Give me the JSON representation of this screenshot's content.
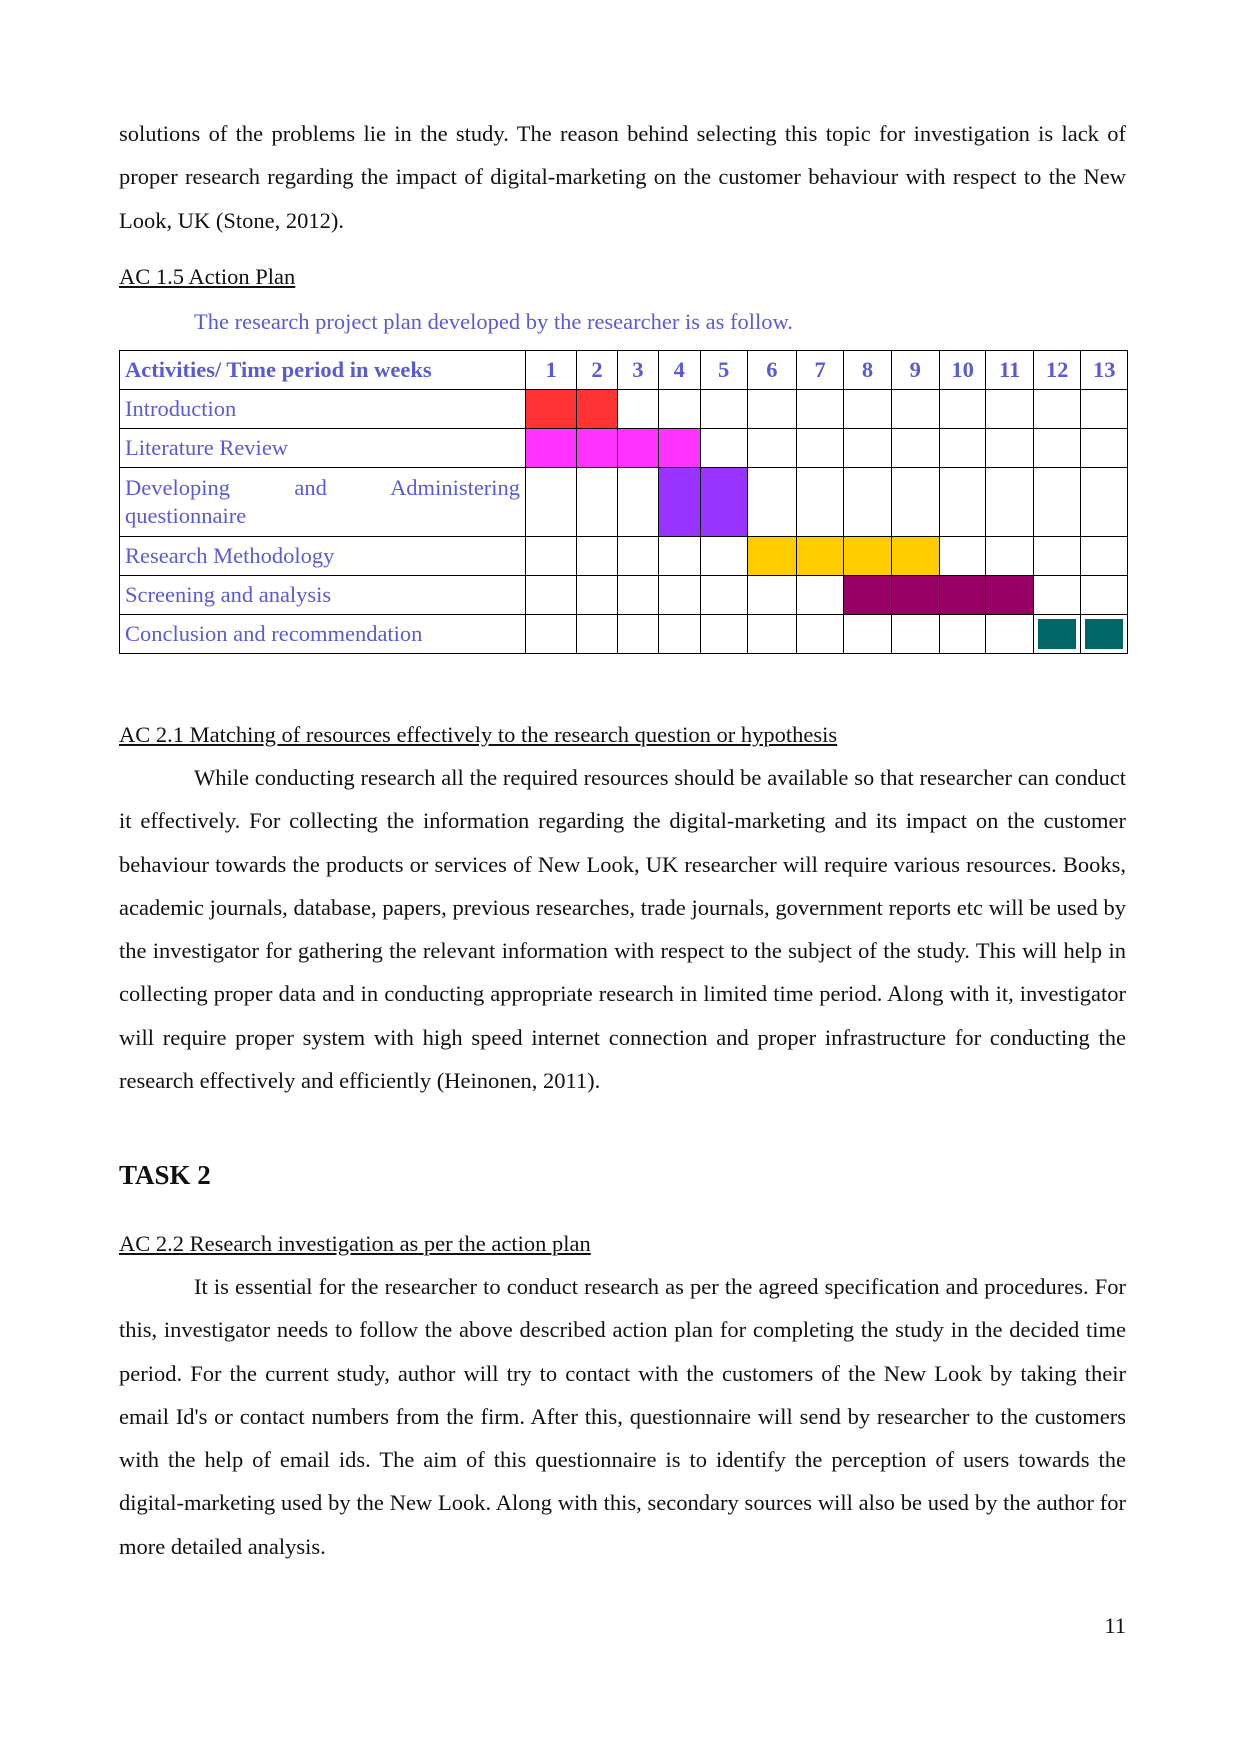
{
  "intro_paragraph": "solutions of the problems lie in the study. The reason behind selecting this topic for investigation is lack of proper research regarding the impact of digital-marketing on the customer behaviour with respect to the New Look, UK (Stone, 2012).",
  "section_ac15": {
    "heading": "AC 1.5 Action Plan",
    "caption": "The research project plan developed by the researcher is as follow.",
    "table": {
      "header": "Activities/ Time period in weeks",
      "weeks": [
        "1",
        "2",
        "3",
        "4",
        "5",
        "6",
        "7",
        "8",
        "9",
        "10",
        "11",
        "12",
        "13"
      ],
      "rows": [
        {
          "activity": "Introduction",
          "start": 1,
          "end": 2,
          "color": "#ff3333"
        },
        {
          "activity": "Literature Review",
          "start": 1,
          "end": 4,
          "color": "#ff33ff"
        },
        {
          "activity": "Developing and Administering questionnaire",
          "start": 4,
          "end": 5,
          "color": "#9933ff"
        },
        {
          "activity": "Research Methodology",
          "start": 6,
          "end": 9,
          "color": "#ffcc00"
        },
        {
          "activity": "Screening and analysis",
          "start": 8,
          "end": 11,
          "color": "#990066"
        },
        {
          "activity": "Conclusion and recommendation",
          "start": 12,
          "end": 13,
          "color": "#006666"
        }
      ]
    }
  },
  "section_ac21": {
    "heading": "AC 2.1 Matching of resources effectively to the research question or hypothesis",
    "paragraph": "While conducting research all the required resources should be available so that researcher can conduct it effectively. For collecting the information regarding the digital-marketing and its impact on the customer behaviour towards the products or services of New Look, UK researcher will require various resources. Books, academic journals, database, papers, previous researches, trade journals, government reports etc will be used by the investigator for gathering the relevant information with respect to the subject of the study. This will help in collecting proper data and in conducting appropriate research in limited time period. Along with it, investigator will require proper system with high speed internet connection and proper infrastructure for conducting the research effectively and efficiently (Heinonen, 2011)."
  },
  "task_heading": "TASK 2",
  "section_ac22": {
    "heading": "AC 2.2 Research investigation as per the action plan",
    "paragraph": "It is essential for the researcher to conduct research as per the agreed specification and procedures. For this, investigator needs to follow the above described action plan for completing the study in the decided time period. For the current study, author will try to contact with the customers of the New Look by taking their email Id's or contact numbers from the firm. After this, questionnaire will send by researcher to the customers with the help of email ids. The aim of this questionnaire is to identify the perception of users towards the digital-marketing used by the New Look. Along with this, secondary sources will also be used by the author for more detailed analysis."
  },
  "page_number": "11"
}
